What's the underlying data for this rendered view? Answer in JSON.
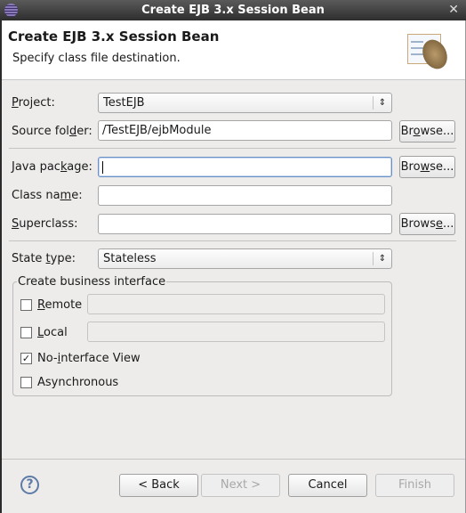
{
  "window": {
    "title": "Create EJB 3.x Session Bean",
    "close_icon": "close-icon"
  },
  "header": {
    "title": "Create EJB 3.x Session Bean",
    "subtitle": "Specify class file destination.",
    "icon": "coffee-bean-class-icon"
  },
  "form": {
    "project": {
      "pre": "",
      "key": "P",
      "post": "roject:",
      "value": "TestEJB"
    },
    "source_folder": {
      "pre": "Source fol",
      "key": "d",
      "post": "er:",
      "value": "/TestEJB/ejbModule",
      "browse": {
        "pre": "Br",
        "key": "o",
        "post": "wse..."
      }
    },
    "java_package": {
      "pre": "Java pac",
      "key": "k",
      "post": "age:",
      "value": "",
      "browse": {
        "pre": "Bro",
        "key": "w",
        "post": "se..."
      }
    },
    "class_name": {
      "pre": "Class na",
      "key": "m",
      "post": "e:",
      "value": ""
    },
    "superclass": {
      "pre": "",
      "key": "S",
      "post": "uperclass:",
      "value": "",
      "browse": {
        "pre": "Brows",
        "key": "e",
        "post": "..."
      }
    },
    "state_type": {
      "pre": "State ",
      "key": "t",
      "post": "ype:",
      "value": "Stateless"
    }
  },
  "business_interface": {
    "title": "Create business interface",
    "remote": {
      "pre": "",
      "key": "R",
      "post": "emote",
      "checked": false,
      "value": ""
    },
    "local": {
      "pre": "",
      "key": "L",
      "post": "ocal",
      "checked": false,
      "value": ""
    },
    "no_interface": {
      "pre": "No-",
      "key": "i",
      "post": "nterface View",
      "checked": true
    },
    "asynchronous": {
      "label": "Asynchronous",
      "checked": false
    }
  },
  "footer": {
    "back": "< Back",
    "next": "Next >",
    "cancel": "Cancel",
    "finish": "Finish",
    "check_mark": "✓",
    "help": "?"
  }
}
